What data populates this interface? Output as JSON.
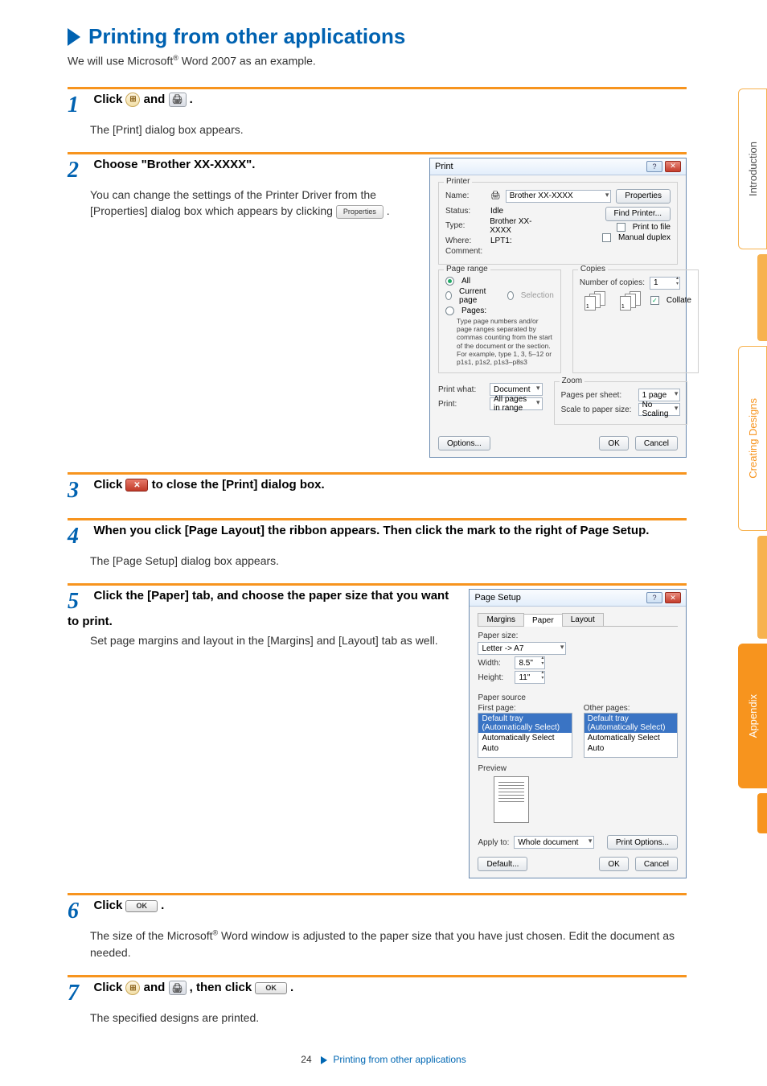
{
  "section": {
    "title": "Printing from other applications"
  },
  "intro": {
    "before_sup": "We will use Microsoft",
    "sup": "®",
    "after_sup": " Word 2007 as an example."
  },
  "side_tabs": {
    "introduction": "Introduction",
    "designs": "Creating Designs",
    "appendix": "Appendix"
  },
  "steps": {
    "s1": {
      "head_a": "Click ",
      "head_b": " and ",
      "head_c": " .",
      "body": "The [Print] dialog box appears."
    },
    "s2": {
      "head": "Choose \"Brother XX-XXXX\".",
      "body_a": "You can change the settings of the Printer Driver from the [Properties] dialog box which appears by clicking ",
      "body_b": " .",
      "properties_btn": "Properties"
    },
    "s3": {
      "head_a": "Click ",
      "head_b": " to close the [Print] dialog box."
    },
    "s4": {
      "head": "When you click [Page Layout] the ribbon appears. Then click the mark to the right of Page Setup.",
      "body": "The [Page Setup] dialog box appears."
    },
    "s5": {
      "head": "Click the [Paper] tab, and choose the paper size that you want to print.",
      "body": "Set page margins and layout in the [Margins] and [Layout] tab as well."
    },
    "s6": {
      "head_a": "Click ",
      "head_b": " .",
      "body_a": "The size of the Microsoft",
      "body_sup": "®",
      "body_b": " Word window is adjusted to the paper size that you have just chosen. Edit the document as needed.",
      "ok_btn": "OK"
    },
    "s7": {
      "head_a": "Click ",
      "head_b": " and ",
      "head_c": " , then click ",
      "head_d": " .",
      "body": "The specified designs are printed.",
      "ok_btn": "OK"
    }
  },
  "print_dialog": {
    "title": "Print",
    "printer_legend": "Printer",
    "name_lbl": "Name:",
    "name_val": "Brother XX-XXXX",
    "properties_btn": "Properties",
    "status_lbl": "Status:",
    "status_val": "Idle",
    "type_lbl": "Type:",
    "type_val": "Brother XX-XXXX",
    "where_lbl": "Where:",
    "where_val": "LPT1:",
    "comment_lbl": "Comment:",
    "find_printer": "Find Printer...",
    "print_to_file": "Print to file",
    "manual_duplex": "Manual duplex",
    "page_range_legend": "Page range",
    "all": "All",
    "current": "Current page",
    "selection": "Selection",
    "pages": "Pages:",
    "pages_hint": "Type page numbers and/or page ranges separated by commas counting from the start of the document or the section. For example, type 1, 3, 5–12 or p1s1, p1s2, p1s3–p8s3",
    "copies_legend": "Copies",
    "num_copies_lbl": "Number of copies:",
    "num_copies_val": "1",
    "collate": "Collate",
    "print_what_lbl": "Print what:",
    "print_what_val": "Document",
    "print_lbl": "Print:",
    "print_val": "All pages in range",
    "zoom_legend": "Zoom",
    "pps_lbl": "Pages per sheet:",
    "pps_val": "1 page",
    "scale_lbl": "Scale to paper size:",
    "scale_val": "No Scaling",
    "options": "Options...",
    "ok": "OK",
    "cancel": "Cancel"
  },
  "page_setup": {
    "title": "Page Setup",
    "tab_margins": "Margins",
    "tab_paper": "Paper",
    "tab_layout": "Layout",
    "paper_size_lbl": "Paper size:",
    "paper_size_val": "Letter -> A7",
    "width_lbl": "Width:",
    "width_val": "8.5\"",
    "height_lbl": "Height:",
    "height_val": "11\"",
    "paper_source_lbl": "Paper source",
    "first_page": "First page:",
    "other_pages": "Other pages:",
    "opt_default": "Default tray (Automatically Select)",
    "opt_auto": "Automatically Select",
    "opt_auto2": "Auto",
    "preview_lbl": "Preview",
    "apply_to_lbl": "Apply to:",
    "apply_to_val": "Whole document",
    "print_options": "Print Options...",
    "default_btn": "Default...",
    "ok": "OK",
    "cancel": "Cancel"
  },
  "footer": {
    "page_num": "24",
    "link": "Printing from other applications"
  }
}
